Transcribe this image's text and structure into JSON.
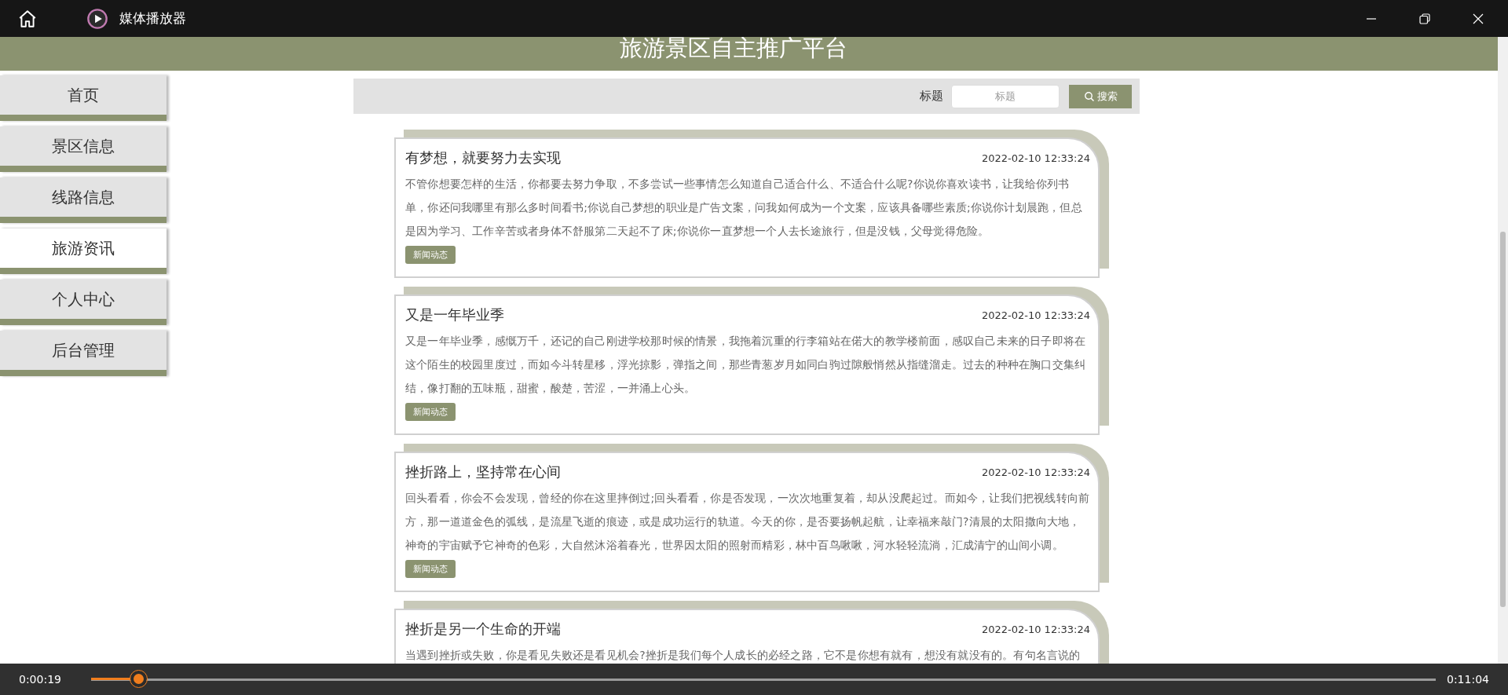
{
  "player": {
    "title": "媒体播放器",
    "elapsed": "0:00:19",
    "duration": "0:11:04",
    "level": 0.035
  },
  "site": {
    "title": "旅游景区自主推广平台"
  },
  "sidebar": {
    "items": [
      {
        "label": "首页",
        "selected": false
      },
      {
        "label": "景区信息",
        "selected": false
      },
      {
        "label": "线路信息",
        "selected": false
      },
      {
        "label": "旅游资讯",
        "selected": true
      },
      {
        "label": "个人中心",
        "selected": false
      },
      {
        "label": "后台管理",
        "selected": false
      }
    ]
  },
  "search": {
    "label": "标题",
    "placeholder": "标题",
    "button": "搜索"
  },
  "news": [
    {
      "title": "有梦想，就要努力去实现",
      "date": "2022-02-10 12:33:24",
      "text": "不管你想要怎样的生活，你都要去努力争取，不多尝试一些事情怎么知道自己适合什么、不适合什么呢?你说你喜欢读书，让我给你列书单，你还问我哪里有那么多时间看书;你说自己梦想的职业是广告文案，问我如何成为一个文案，应该具备哪些素质;你说你计划晨跑，但总是因为学习、工作辛苦或者身体不舒服第二天起不了床;你说你一直梦想一个人去长途旅行，但是没钱，父母觉得危险。",
      "tag": "新闻动态"
    },
    {
      "title": "又是一年毕业季",
      "date": "2022-02-10 12:33:24",
      "text": "又是一年毕业季，感慨万千，还记的自己刚进学校那时候的情景，我拖着沉重的行李箱站在偌大的教学楼前面，感叹自己未来的日子即将在这个陌生的校园里度过，而如今斗转星移，浮光掠影，弹指之间，那些青葱岁月如同白驹过隙般悄然从指缝溜走。过去的种种在胸口交集纠结，像打翻的五味瓶，甜蜜，酸楚，苦涩，一并涌上心头。",
      "tag": "新闻动态"
    },
    {
      "title": "挫折路上，坚持常在心间",
      "date": "2022-02-10 12:33:24",
      "text": "回头看看，你会不会发现，曾经的你在这里摔倒过;回头看看，你是否发现，一次次地重复着，却从没爬起过。而如今，让我们把视线转向前方，那一道道金色的弧线，是流星飞逝的痕迹，或是成功运行的轨道。今天的你，是否要扬帆起航，让幸福来敲门?清晨的太阳撒向大地，神奇的宇宙赋予它神奇的色彩，大自然沐浴着春光，世界因太阳的照射而精彩，林中百鸟啾啾，河水轻轻流淌，汇成清宁的山间小调。",
      "tag": "新闻动态"
    },
    {
      "title": "挫折是另一个生命的开端",
      "date": "2022-02-10 12:33:24",
      "text": "当遇到挫折或失败，你是看见失败还是看见机会?挫折是我们每个人成长的必经之路，它不是你想有就有，想没有就没有的。有句名言说的"
    }
  ]
}
